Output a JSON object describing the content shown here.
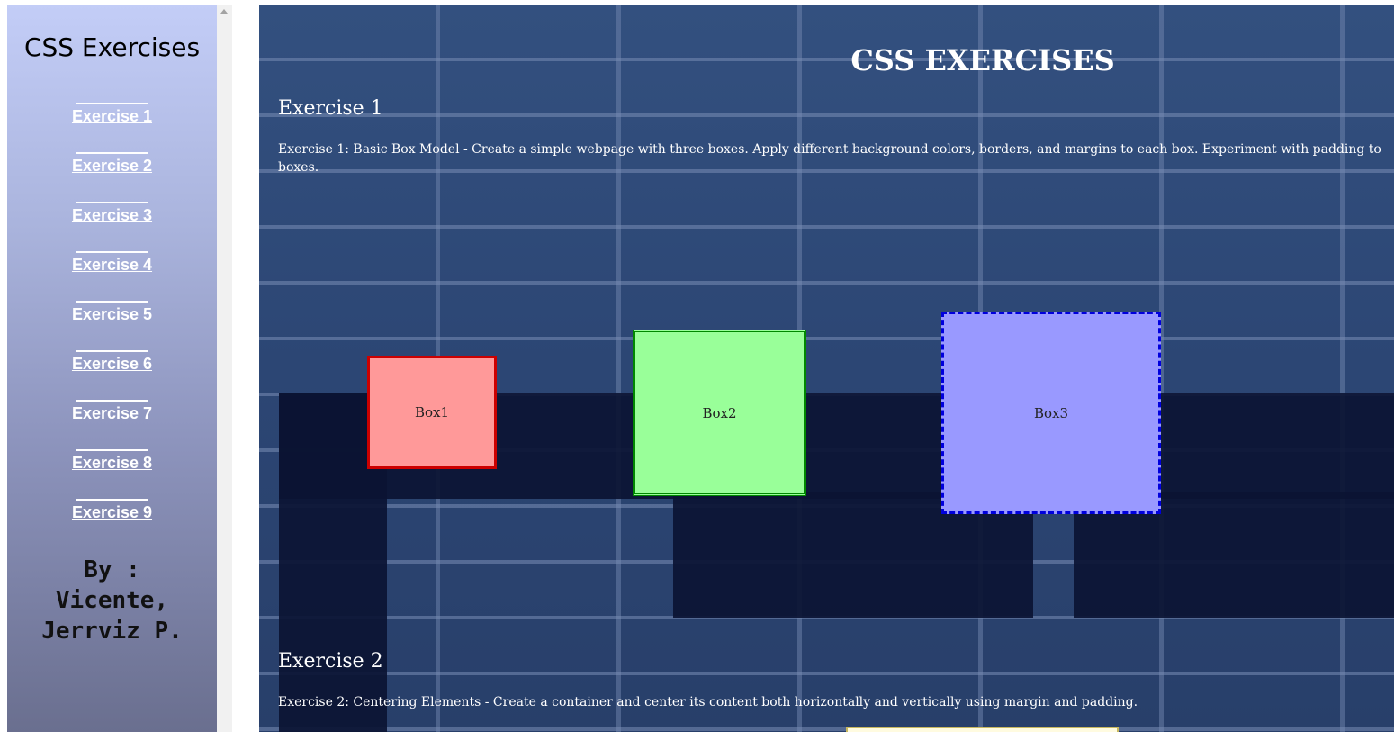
{
  "sidebar": {
    "title": "CSS Exercises",
    "items": [
      {
        "label": "Exercise 1"
      },
      {
        "label": "Exercise 2"
      },
      {
        "label": "Exercise 3"
      },
      {
        "label": "Exercise 4"
      },
      {
        "label": "Exercise 5"
      },
      {
        "label": "Exercise 6"
      },
      {
        "label": "Exercise 7"
      },
      {
        "label": "Exercise 8"
      },
      {
        "label": "Exercise 9"
      }
    ],
    "author_line1": "By :",
    "author_line2": "Vicente,",
    "author_line3": "Jerrviz P."
  },
  "main": {
    "title": "CSS EXERCISES",
    "exercise1": {
      "heading": "Exercise 1",
      "description": "Exercise 1: Basic Box Model - Create a simple webpage with three boxes. Apply different background colors, borders, and margins to each box. Experiment with padding to boxes.",
      "boxes": [
        {
          "label": "Box1",
          "background": "#ff9999",
          "border": "#cc0000"
        },
        {
          "label": "Box2",
          "background": "#99ff99",
          "border": "#008800"
        },
        {
          "label": "Box3",
          "background": "#9999ff",
          "border": "#0000dd"
        }
      ]
    },
    "exercise2": {
      "heading": "Exercise 2",
      "description": "Exercise 2: Centering Elements - Create a container and center its content both horizontally and vertically using margin and padding."
    }
  },
  "colors": {
    "sidebar_top": "#c3cdf7",
    "sidebar_bottom": "#6a6f8f",
    "main_background": "#2f4a78",
    "text": "#ffffff"
  },
  "icons": {
    "scroll_up": "scroll-up-arrow-icon"
  }
}
